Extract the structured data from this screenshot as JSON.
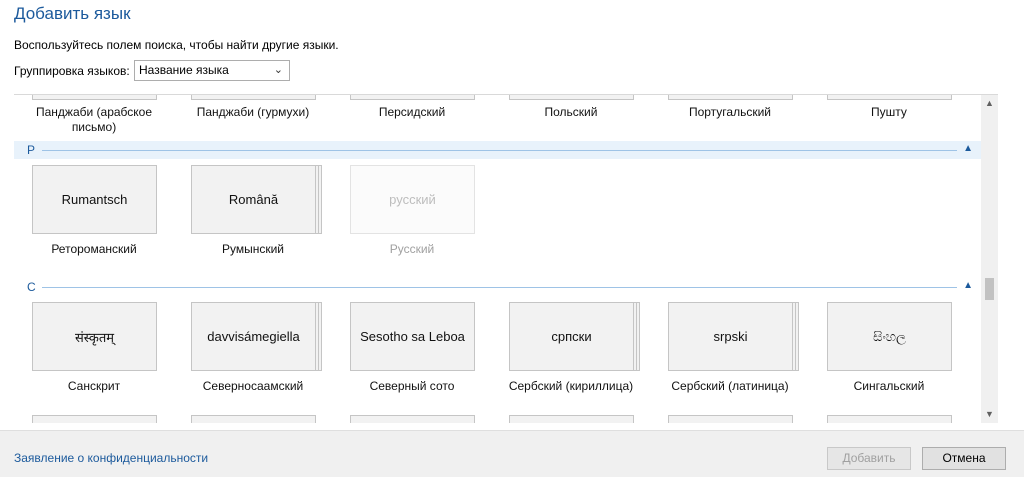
{
  "dialog": {
    "title": "Добавить язык",
    "description": "Воспользуйтесь полем поиска, чтобы найти другие языки.",
    "group_label": "Группировка языков:",
    "group_value": "Название языка"
  },
  "top_row": [
    "Панджаби (арабское письмо)",
    "Панджаби (гурмухи)",
    "Персидский",
    "Польский",
    "Португальский",
    "Пушту"
  ],
  "groups": [
    {
      "letter": "Р",
      "items": [
        {
          "native": "Rumantsch",
          "name": "Ретороманский",
          "multi": false,
          "disabled": false
        },
        {
          "native": "Română",
          "name": "Румынский",
          "multi": true,
          "disabled": false
        },
        {
          "native": "русский",
          "name": "Русский",
          "multi": false,
          "disabled": true
        }
      ]
    },
    {
      "letter": "С",
      "items": [
        {
          "native": "संस्कृतम्",
          "name": "Санскрит",
          "multi": false,
          "disabled": false
        },
        {
          "native": "davvisámegiella",
          "name": "Северносаамский",
          "multi": true,
          "disabled": false
        },
        {
          "native": "Sesotho sa Leboa",
          "name": "Северный сото",
          "multi": false,
          "disabled": false
        },
        {
          "native": "српски",
          "name": "Сербский (кириллица)",
          "multi": true,
          "disabled": false
        },
        {
          "native": "srpski",
          "name": "Сербский (латиница)",
          "multi": true,
          "disabled": false
        },
        {
          "native": "සිංහල",
          "name": "Сингальский",
          "multi": false,
          "disabled": false
        }
      ]
    }
  ],
  "footer": {
    "privacy": "Заявление о конфиденциальности",
    "add": "Добавить",
    "cancel": "Отмена"
  },
  "icons": {
    "dropdown": "chevron-down-icon",
    "collapse": "chevron-up-icon",
    "scroll_up": "scroll-up-icon",
    "scroll_down": "scroll-down-icon"
  },
  "colors": {
    "accent": "#1c5a9c",
    "tile_bg": "#f2f2f2",
    "footer_bg": "#f0f0f0"
  }
}
